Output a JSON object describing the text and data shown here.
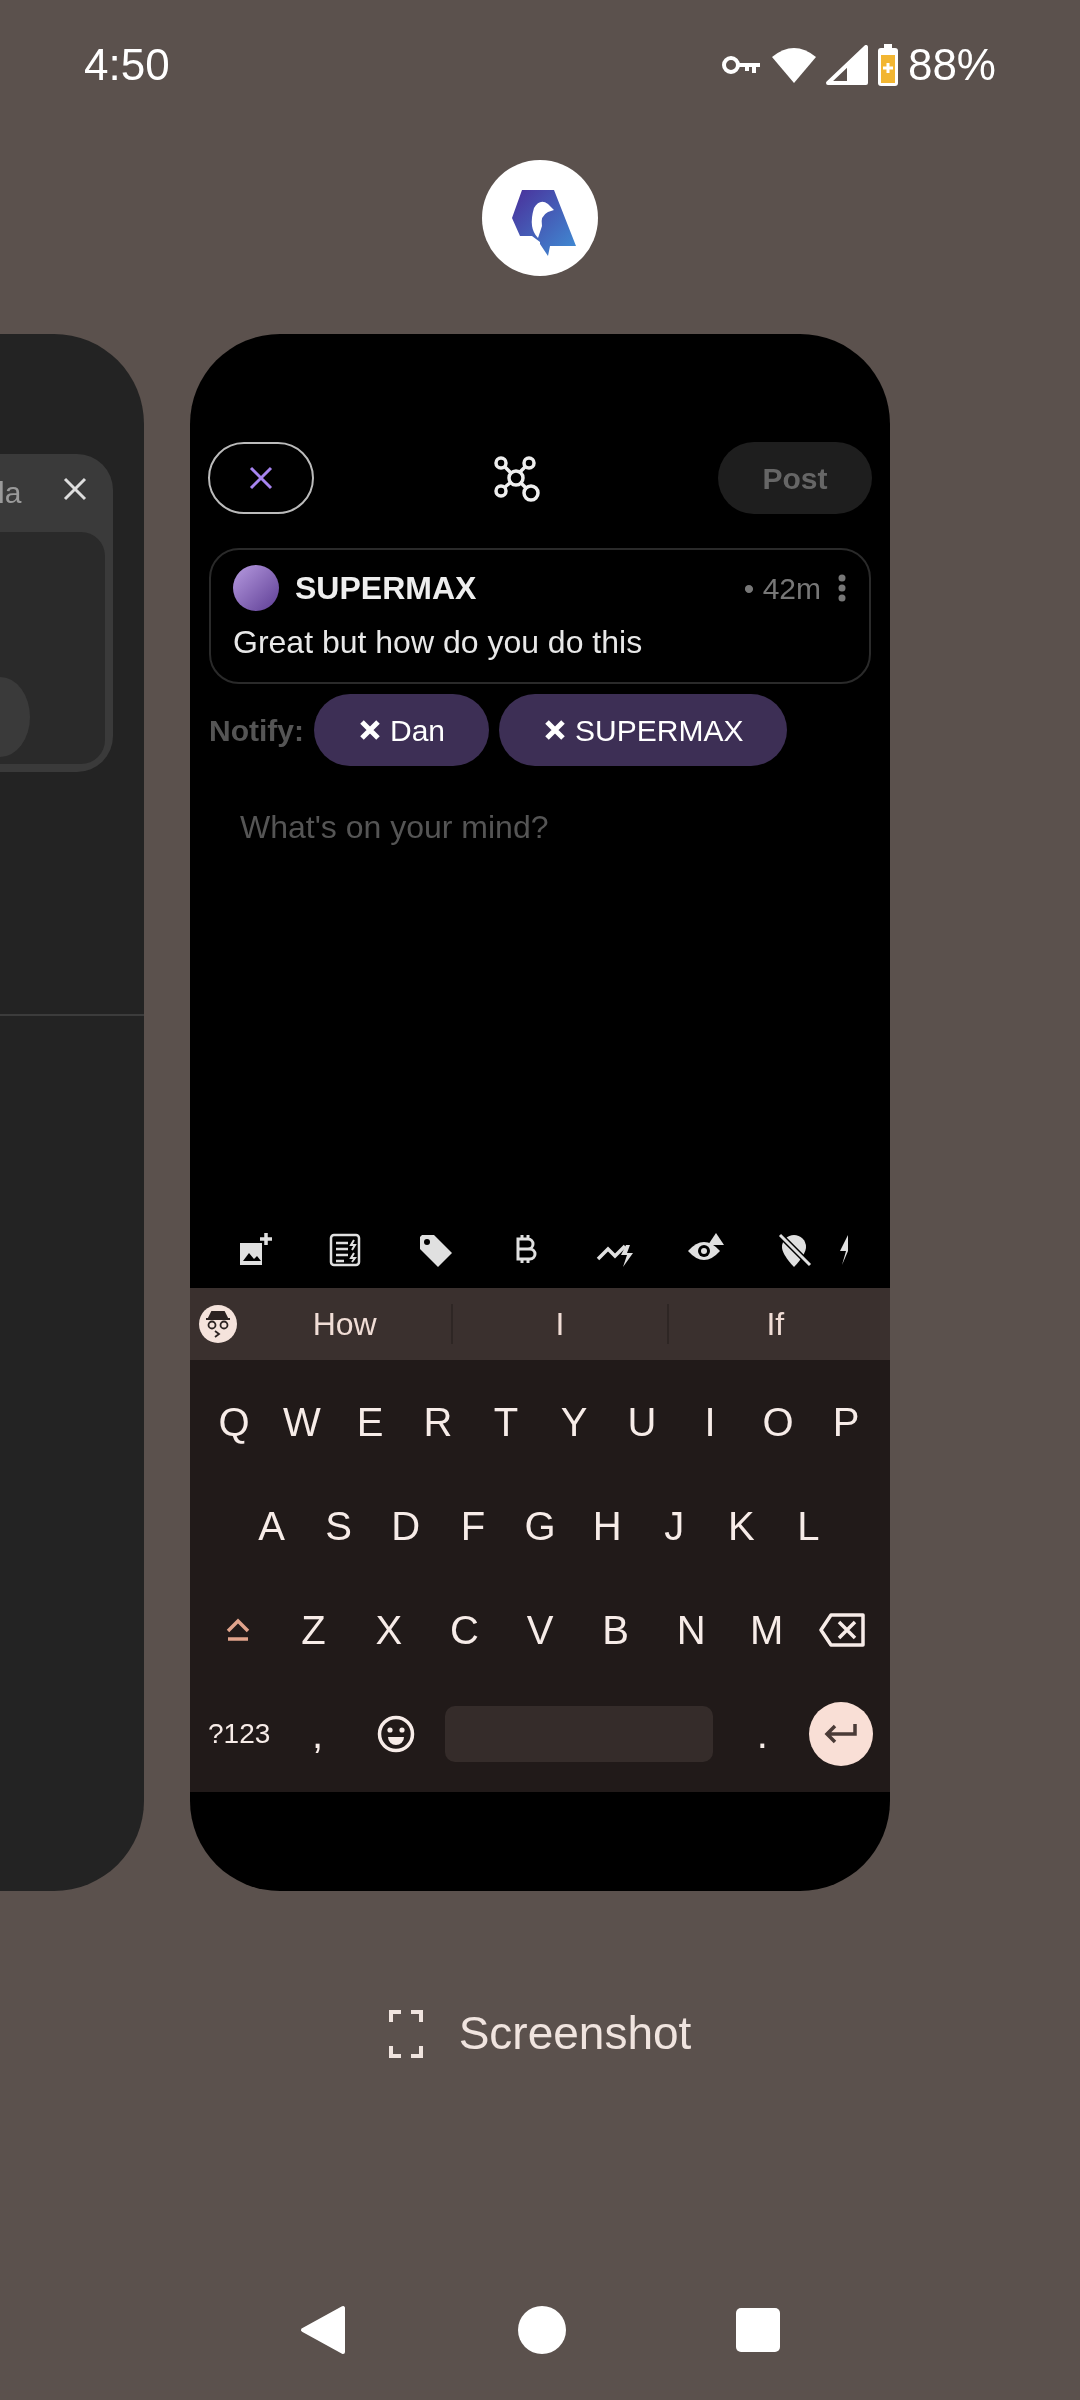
{
  "status_bar": {
    "time": "4:50",
    "battery": "88%"
  },
  "left_card": {
    "title": "la"
  },
  "composer": {
    "post_button": "Post",
    "quoted_note": {
      "author": "SUPERMAX",
      "time": "• 42m",
      "text": "Great but how do you do this"
    },
    "notify": {
      "label": "Notify:",
      "chips": [
        "Dan",
        "SUPERMAX"
      ]
    },
    "placeholder": "What's on your mind?"
  },
  "keyboard": {
    "suggestions": [
      "How",
      "I",
      "If"
    ],
    "rows": [
      [
        {
          "kind": "char",
          "label": "Q"
        },
        {
          "kind": "char",
          "label": "W"
        },
        {
          "kind": "char",
          "label": "E"
        },
        {
          "kind": "char",
          "label": "R"
        },
        {
          "kind": "char",
          "label": "T"
        },
        {
          "kind": "char",
          "label": "Y"
        },
        {
          "kind": "char",
          "label": "U"
        },
        {
          "kind": "char",
          "label": "I"
        },
        {
          "kind": "char",
          "label": "O"
        },
        {
          "kind": "char",
          "label": "P"
        }
      ],
      [
        {
          "kind": "char",
          "label": "A"
        },
        {
          "kind": "char",
          "label": "S"
        },
        {
          "kind": "char",
          "label": "D"
        },
        {
          "kind": "char",
          "label": "F"
        },
        {
          "kind": "char",
          "label": "G"
        },
        {
          "kind": "char",
          "label": "H"
        },
        {
          "kind": "char",
          "label": "J"
        },
        {
          "kind": "char",
          "label": "K"
        },
        {
          "kind": "char",
          "label": "L"
        }
      ],
      [
        {
          "kind": "shift"
        },
        {
          "kind": "char",
          "label": "Z"
        },
        {
          "kind": "char",
          "label": "X"
        },
        {
          "kind": "char",
          "label": "C"
        },
        {
          "kind": "char",
          "label": "V"
        },
        {
          "kind": "char",
          "label": "B"
        },
        {
          "kind": "char",
          "label": "N"
        },
        {
          "kind": "char",
          "label": "M"
        },
        {
          "kind": "backspace"
        }
      ],
      [
        {
          "kind": "symbols",
          "label": "?123"
        },
        {
          "kind": "char",
          "label": ","
        },
        {
          "kind": "emoji"
        },
        {
          "kind": "space"
        },
        {
          "kind": "char",
          "label": "."
        },
        {
          "kind": "enter"
        }
      ]
    ]
  },
  "screenshot_action": "Screenshot"
}
